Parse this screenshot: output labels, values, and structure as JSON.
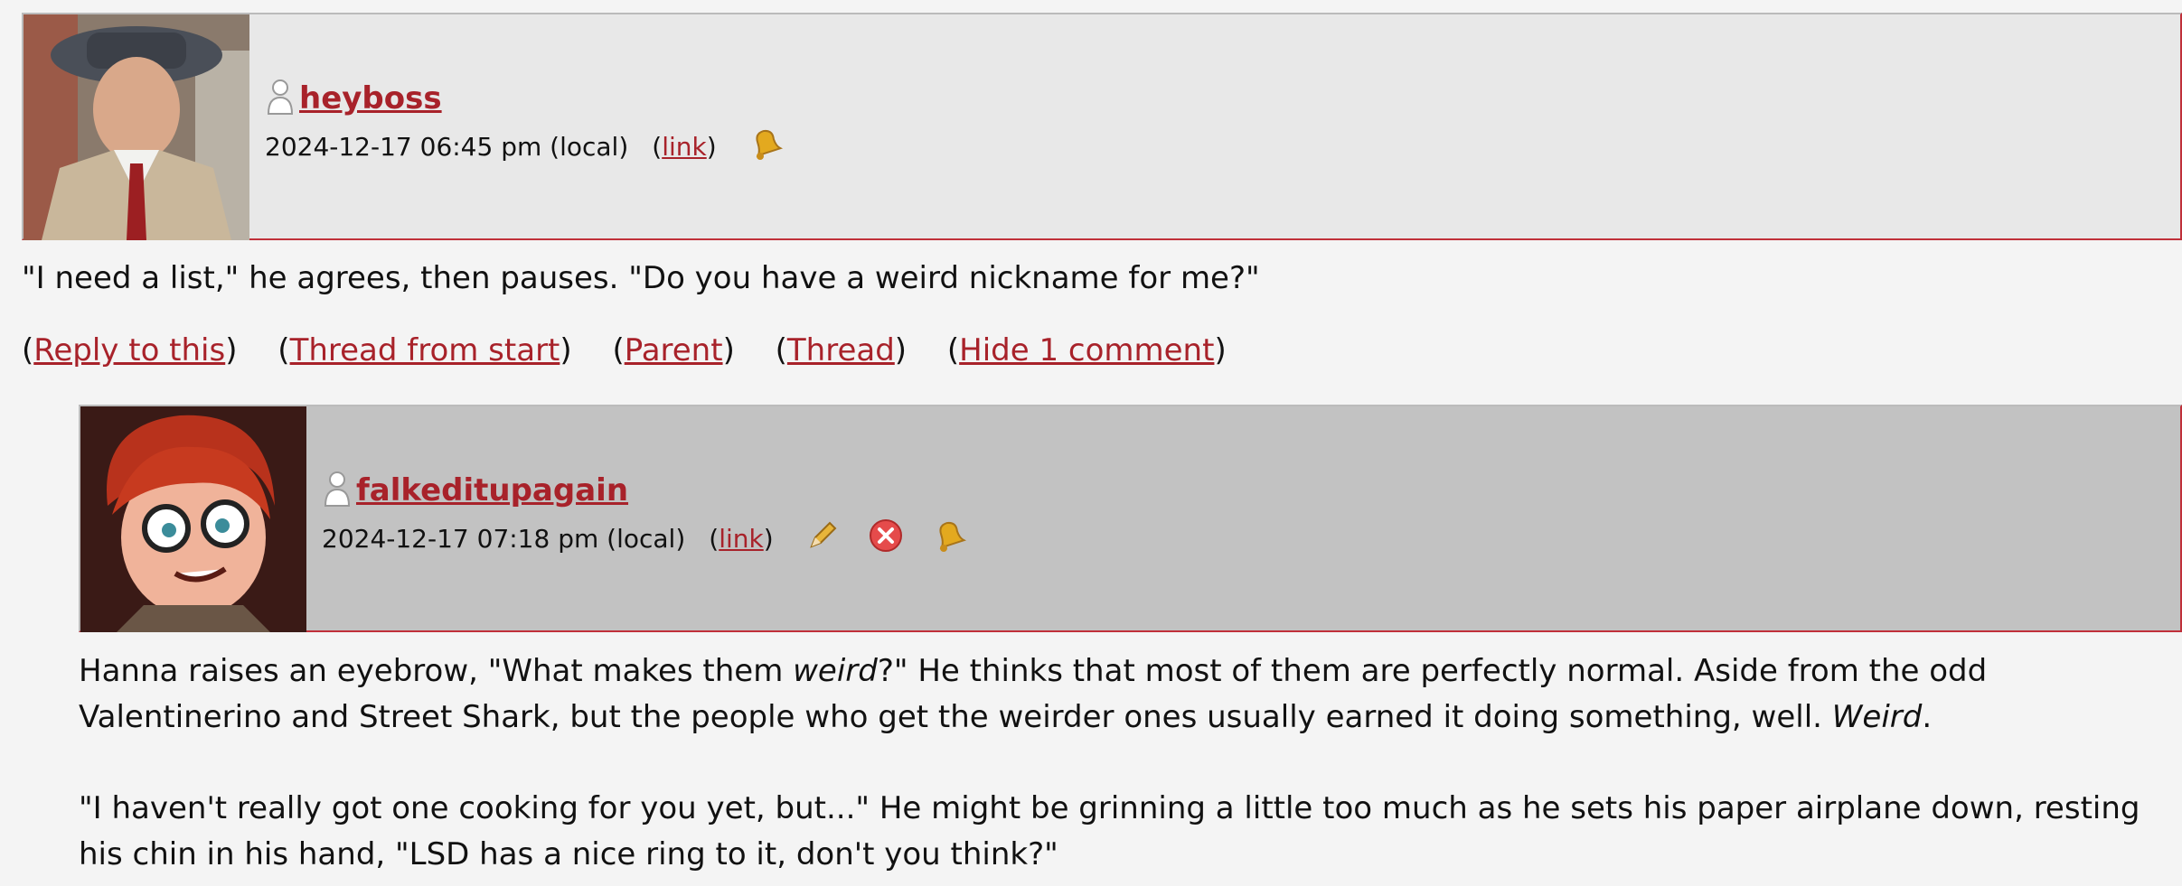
{
  "comment1": {
    "username": "heyboss",
    "timestamp": "2024-12-17 06:45 pm (local)",
    "link_label": "link",
    "body": "\"I need a list,\" he agrees, then pauses. \"Do you have a weird nickname for me?\"",
    "actions": {
      "reply": "Reply to this",
      "thread_from_start": "Thread from start",
      "parent": "Parent",
      "thread": "Thread",
      "hide": "Hide 1 comment"
    },
    "icons": [
      "user-icon",
      "bell-icon"
    ]
  },
  "comment2": {
    "username": "falkeditupagain",
    "timestamp": "2024-12-17 07:18 pm (local)",
    "link_label": "link",
    "p1_a": "Hanna raises an eyebrow, \"What makes them ",
    "p1_em": "weird",
    "p1_b": "?\" He thinks that most of them are perfectly normal. Aside from the odd Valentinerino and Street Shark, but the people who get the weirder ones usually earned it doing something, well. ",
    "p1_em2": "Weird",
    "p1_c": ".",
    "p2": "\"I haven't really got one cooking for you yet, but...\" He might be grinning a little too much as he sets his paper airplane down, resting his chin in his hand, \"LSD has a nice ring to it, don't you think?\"",
    "icons": [
      "user-icon",
      "pencil-icon",
      "delete-icon",
      "bell-icon"
    ]
  },
  "colors": {
    "link": "#a8222a",
    "header1_bg": "#e8e8e8",
    "header2_bg": "#c2c2c2",
    "border": "#c0303a",
    "page_bg": "#f4f4f4"
  }
}
